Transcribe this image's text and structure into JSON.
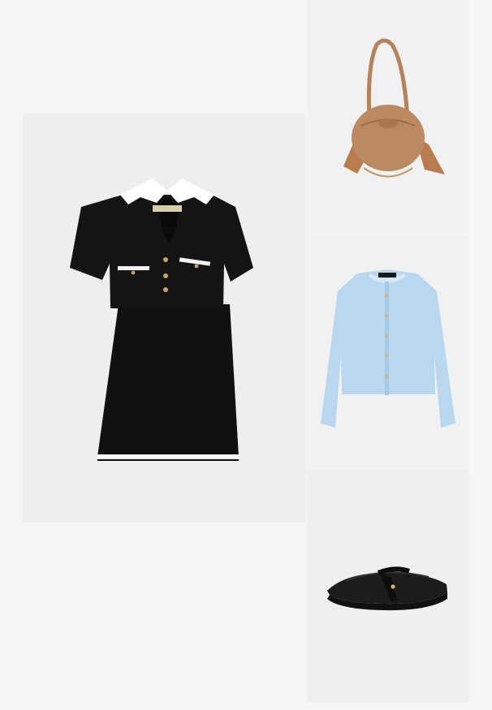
{
  "outfit": {
    "items": [
      {
        "name": "dress",
        "icon": "dress-with-cropped-jacket"
      },
      {
        "name": "bag",
        "icon": "fringed-shoulder-bag"
      },
      {
        "name": "cardigan",
        "icon": "light-blue-cardigan"
      },
      {
        "name": "shoes",
        "icon": "black-mesh-ballet-flat"
      }
    ],
    "colors": {
      "background": "#f6f6f6",
      "dress": "#111111",
      "bag": "#b9875f",
      "cardigan": "#b9d8f0",
      "shoe": "#1a1a1a"
    }
  }
}
